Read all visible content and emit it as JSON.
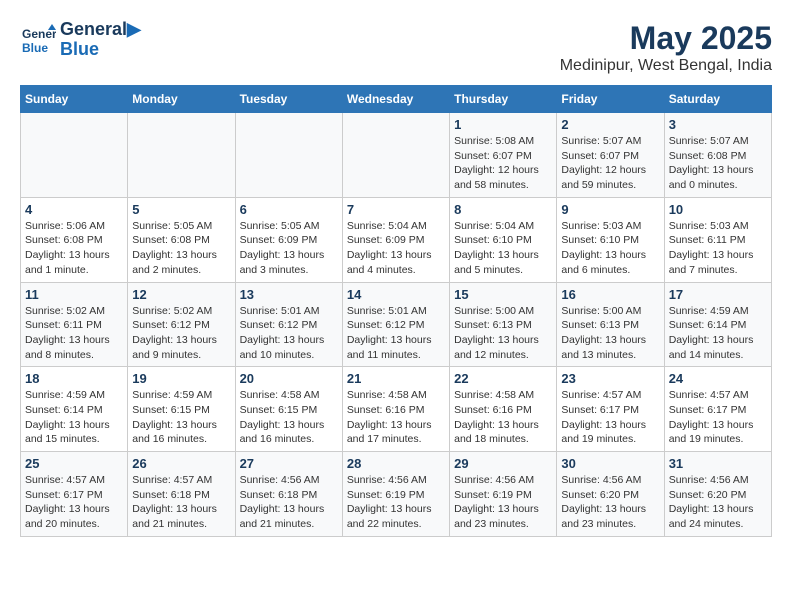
{
  "header": {
    "logo": {
      "line1": "General",
      "line2": "Blue"
    },
    "title": "May 2025",
    "subtitle": "Medinipur, West Bengal, India"
  },
  "weekdays": [
    "Sunday",
    "Monday",
    "Tuesday",
    "Wednesday",
    "Thursday",
    "Friday",
    "Saturday"
  ],
  "weeks": [
    [
      {
        "day": "",
        "info": ""
      },
      {
        "day": "",
        "info": ""
      },
      {
        "day": "",
        "info": ""
      },
      {
        "day": "",
        "info": ""
      },
      {
        "day": "1",
        "info": "Sunrise: 5:08 AM\nSunset: 6:07 PM\nDaylight: 12 hours\nand 58 minutes."
      },
      {
        "day": "2",
        "info": "Sunrise: 5:07 AM\nSunset: 6:07 PM\nDaylight: 12 hours\nand 59 minutes."
      },
      {
        "day": "3",
        "info": "Sunrise: 5:07 AM\nSunset: 6:08 PM\nDaylight: 13 hours\nand 0 minutes."
      }
    ],
    [
      {
        "day": "4",
        "info": "Sunrise: 5:06 AM\nSunset: 6:08 PM\nDaylight: 13 hours\nand 1 minute."
      },
      {
        "day": "5",
        "info": "Sunrise: 5:05 AM\nSunset: 6:08 PM\nDaylight: 13 hours\nand 2 minutes."
      },
      {
        "day": "6",
        "info": "Sunrise: 5:05 AM\nSunset: 6:09 PM\nDaylight: 13 hours\nand 3 minutes."
      },
      {
        "day": "7",
        "info": "Sunrise: 5:04 AM\nSunset: 6:09 PM\nDaylight: 13 hours\nand 4 minutes."
      },
      {
        "day": "8",
        "info": "Sunrise: 5:04 AM\nSunset: 6:10 PM\nDaylight: 13 hours\nand 5 minutes."
      },
      {
        "day": "9",
        "info": "Sunrise: 5:03 AM\nSunset: 6:10 PM\nDaylight: 13 hours\nand 6 minutes."
      },
      {
        "day": "10",
        "info": "Sunrise: 5:03 AM\nSunset: 6:11 PM\nDaylight: 13 hours\nand 7 minutes."
      }
    ],
    [
      {
        "day": "11",
        "info": "Sunrise: 5:02 AM\nSunset: 6:11 PM\nDaylight: 13 hours\nand 8 minutes."
      },
      {
        "day": "12",
        "info": "Sunrise: 5:02 AM\nSunset: 6:12 PM\nDaylight: 13 hours\nand 9 minutes."
      },
      {
        "day": "13",
        "info": "Sunrise: 5:01 AM\nSunset: 6:12 PM\nDaylight: 13 hours\nand 10 minutes."
      },
      {
        "day": "14",
        "info": "Sunrise: 5:01 AM\nSunset: 6:12 PM\nDaylight: 13 hours\nand 11 minutes."
      },
      {
        "day": "15",
        "info": "Sunrise: 5:00 AM\nSunset: 6:13 PM\nDaylight: 13 hours\nand 12 minutes."
      },
      {
        "day": "16",
        "info": "Sunrise: 5:00 AM\nSunset: 6:13 PM\nDaylight: 13 hours\nand 13 minutes."
      },
      {
        "day": "17",
        "info": "Sunrise: 4:59 AM\nSunset: 6:14 PM\nDaylight: 13 hours\nand 14 minutes."
      }
    ],
    [
      {
        "day": "18",
        "info": "Sunrise: 4:59 AM\nSunset: 6:14 PM\nDaylight: 13 hours\nand 15 minutes."
      },
      {
        "day": "19",
        "info": "Sunrise: 4:59 AM\nSunset: 6:15 PM\nDaylight: 13 hours\nand 16 minutes."
      },
      {
        "day": "20",
        "info": "Sunrise: 4:58 AM\nSunset: 6:15 PM\nDaylight: 13 hours\nand 16 minutes."
      },
      {
        "day": "21",
        "info": "Sunrise: 4:58 AM\nSunset: 6:16 PM\nDaylight: 13 hours\nand 17 minutes."
      },
      {
        "day": "22",
        "info": "Sunrise: 4:58 AM\nSunset: 6:16 PM\nDaylight: 13 hours\nand 18 minutes."
      },
      {
        "day": "23",
        "info": "Sunrise: 4:57 AM\nSunset: 6:17 PM\nDaylight: 13 hours\nand 19 minutes."
      },
      {
        "day": "24",
        "info": "Sunrise: 4:57 AM\nSunset: 6:17 PM\nDaylight: 13 hours\nand 19 minutes."
      }
    ],
    [
      {
        "day": "25",
        "info": "Sunrise: 4:57 AM\nSunset: 6:17 PM\nDaylight: 13 hours\nand 20 minutes."
      },
      {
        "day": "26",
        "info": "Sunrise: 4:57 AM\nSunset: 6:18 PM\nDaylight: 13 hours\nand 21 minutes."
      },
      {
        "day": "27",
        "info": "Sunrise: 4:56 AM\nSunset: 6:18 PM\nDaylight: 13 hours\nand 21 minutes."
      },
      {
        "day": "28",
        "info": "Sunrise: 4:56 AM\nSunset: 6:19 PM\nDaylight: 13 hours\nand 22 minutes."
      },
      {
        "day": "29",
        "info": "Sunrise: 4:56 AM\nSunset: 6:19 PM\nDaylight: 13 hours\nand 23 minutes."
      },
      {
        "day": "30",
        "info": "Sunrise: 4:56 AM\nSunset: 6:20 PM\nDaylight: 13 hours\nand 23 minutes."
      },
      {
        "day": "31",
        "info": "Sunrise: 4:56 AM\nSunset: 6:20 PM\nDaylight: 13 hours\nand 24 minutes."
      }
    ]
  ]
}
